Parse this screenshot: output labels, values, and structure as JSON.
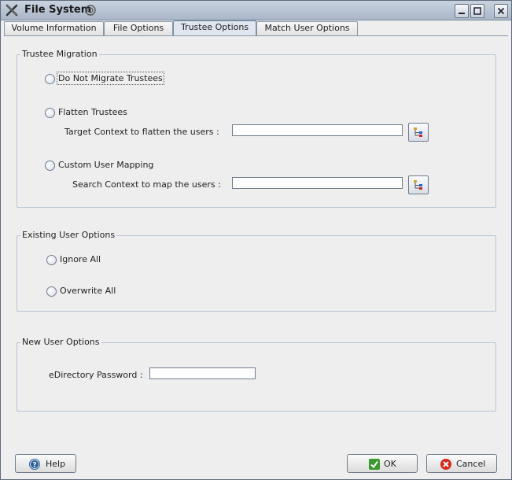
{
  "window": {
    "title": "File System",
    "icon": "x-tool-icon",
    "controls": [
      "minimize-icon",
      "maximize-icon",
      "close-icon"
    ]
  },
  "tabs": [
    {
      "label": "Volume Information",
      "active": false
    },
    {
      "label": "File Options",
      "active": false
    },
    {
      "label": "Trustee Options",
      "active": true
    },
    {
      "label": "Match User Options",
      "active": false
    }
  ],
  "trustee_migration": {
    "title": "Trustee Migration",
    "do_not_migrate_label": "Do Not Migrate Trustees",
    "flatten_label": "Flatten Trustees",
    "target_context_label": "Target Context to flatten the users :",
    "target_context_value": "",
    "custom_mapping_label": "Custom User Mapping",
    "search_context_label": "Search Context to map the users :",
    "search_context_value": ""
  },
  "existing_user_options": {
    "title": "Existing User Options",
    "ignore_all_label": "Ignore All",
    "overwrite_all_label": "Overwrite All"
  },
  "new_user_options": {
    "title": "New User Options",
    "password_label": "eDirectory Password :",
    "password_value": ""
  },
  "buttons": {
    "help": "Help",
    "ok": "OK",
    "cancel": "Cancel"
  },
  "colors": {
    "titlebar": "#a9b6c8",
    "ok_icon": "#3a9a2e",
    "cancel_icon": "#d9261c",
    "help_icon": "#2b5f9e"
  }
}
